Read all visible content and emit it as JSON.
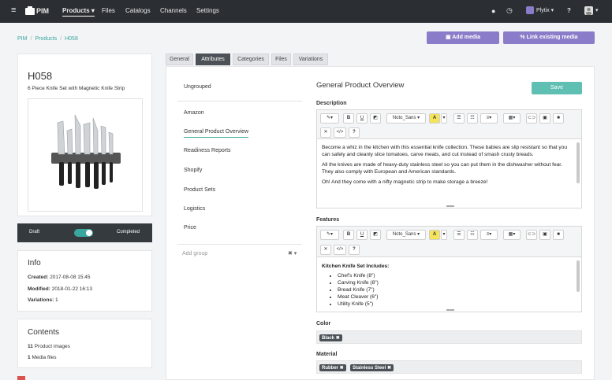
{
  "nav": {
    "brand": "PIM",
    "menu": [
      "Products",
      "Files",
      "Catalogs",
      "Channels",
      "Settings"
    ],
    "account": "Plytix"
  },
  "breadcrumb": [
    "PIM",
    "Products",
    "H058"
  ],
  "actions": {
    "add_media": "Add media",
    "link_media": "Link existing media"
  },
  "product": {
    "sku": "H058",
    "name": "6 Piece Knife Set with Magnetic Knife Strip",
    "status_left": "Draft",
    "status_right": "Completed"
  },
  "info": {
    "title": "Info",
    "created_label": "Created:",
    "created": "2017-08-08 15:45",
    "modified_label": "Modified:",
    "modified": "2018-01-22 16:13",
    "variations_label": "Variations:",
    "variations": "1"
  },
  "contents": {
    "title": "Contents",
    "images_count": "11",
    "images_label": "Product images",
    "media_count": "1",
    "media_label": "Media files"
  },
  "tabs": [
    "General",
    "Attributes",
    "Categories",
    "Files",
    "Variations"
  ],
  "groups": {
    "ungrouped": "Ungrouped",
    "items": [
      "Amazon",
      "General Product Overview",
      "Readiness Reports",
      "Shopify",
      "Product Sets",
      "Logistics",
      "Price"
    ],
    "add_placeholder": "Add group"
  },
  "overview": {
    "title": "General Product Overview",
    "save": "Save",
    "font": "Noto_Sans",
    "description_label": "Description",
    "description": [
      "Become a whiz in the kitchen with this essential knife collection. These babies are slip resistant so that you can safely and cleanly slice tomatoes, carve meats, and cut instead of smash crusty breads.",
      "All the knives are made of heavy-duty stainless steel so you can put them in the dishwasher without fear. They also comply with European and American standards.",
      "Oh! And they come with a nifty magnetic strip to make storage a breeze!"
    ],
    "features_label": "Features",
    "features_heading": "Kitchen Knife Set Includes:",
    "features": [
      "Chef's Knife (8\")",
      "Carving Knife (8\")",
      "Bread Knife (7\")",
      "Meat Cleaver (6\")",
      "Utility Knife (5\")"
    ],
    "color_label": "Color",
    "colors": [
      "Black"
    ],
    "material_label": "Material",
    "materials": [
      "Rubber",
      "Stainless Steel"
    ]
  },
  "colors": {
    "accent": "#3aa6a0",
    "purple": "#8a7cc8",
    "dark": "#2b2f33"
  }
}
